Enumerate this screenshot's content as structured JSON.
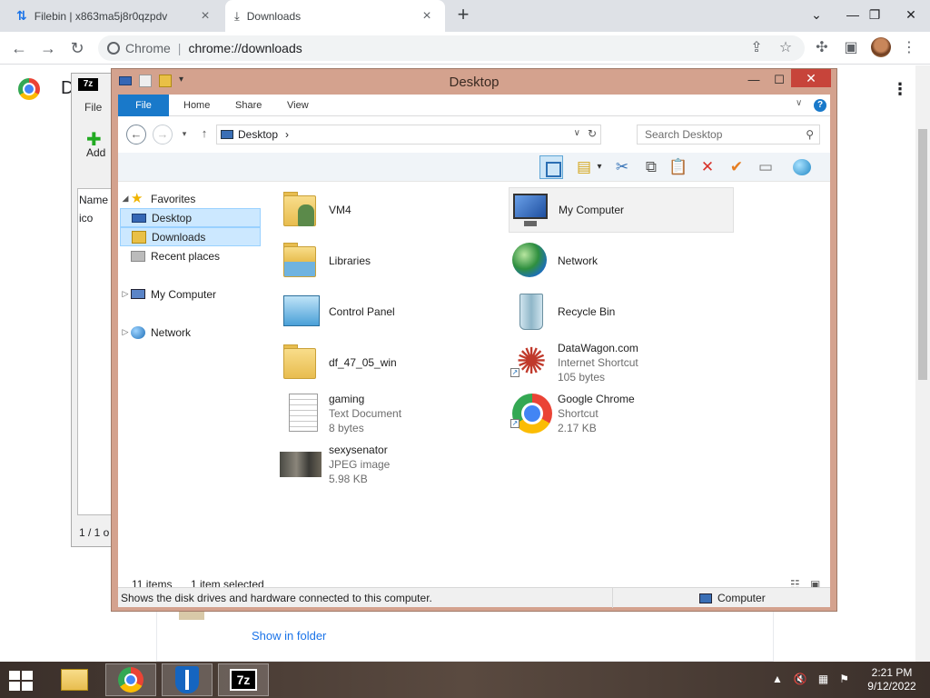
{
  "browser": {
    "tabs": [
      {
        "title": "Filebin | x863ma5j8r0qzpdv",
        "active": false
      },
      {
        "title": "Downloads",
        "active": true
      }
    ],
    "new_tab": "+",
    "omnibox": {
      "site": "Chrome",
      "separator": "|",
      "url": "chrome://downloads"
    },
    "window_controls": {
      "minimize": "—",
      "restore": "❐",
      "close": "✕",
      "dropdown": "⌄"
    },
    "icons": {
      "back": "back-arrow-icon",
      "forward": "forward-arrow-icon",
      "reload": "reload-icon",
      "share": "share-icon",
      "bookmark": "star-icon",
      "extensions": "puzzle-icon",
      "sidepanel": "side-panel-icon",
      "menu": "kebab-menu-icon"
    }
  },
  "downloads_page": {
    "heading_initial": "D",
    "show_in_folder": "Show in folder",
    "menu": "⋮"
  },
  "sevenzip": {
    "logo": "7z",
    "menu_file": "File",
    "add_label": "Add",
    "column_name": "Name",
    "row_name": "ico",
    "status": "1 / 1 o"
  },
  "explorer": {
    "title": "Desktop",
    "window_controls": {
      "minimize": "—",
      "maximize": "☐",
      "close": "✕"
    },
    "ribbon_tabs": [
      "File",
      "Home",
      "Share",
      "View"
    ],
    "help": "?",
    "address": {
      "location": "Desktop",
      "chevron": "›"
    },
    "search_placeholder": "Search Desktop",
    "nav": {
      "favorites": "Favorites",
      "desktop": "Desktop",
      "downloads": "Downloads",
      "recent": "Recent places",
      "my_computer": "My Computer",
      "network": "Network"
    },
    "items": [
      {
        "name": "VM4",
        "line2": "",
        "line3": ""
      },
      {
        "name": "My Computer",
        "line2": "",
        "line3": ""
      },
      {
        "name": "Libraries",
        "line2": "",
        "line3": ""
      },
      {
        "name": "Network",
        "line2": "",
        "line3": ""
      },
      {
        "name": "Control Panel",
        "line2": "",
        "line3": ""
      },
      {
        "name": "Recycle Bin",
        "line2": "",
        "line3": ""
      },
      {
        "name": "df_47_05_win",
        "line2": "",
        "line3": ""
      },
      {
        "name": "DataWagon.com",
        "line2": "Internet Shortcut",
        "line3": "105 bytes"
      },
      {
        "name": "gaming",
        "line2": "Text Document",
        "line3": "8 bytes"
      },
      {
        "name": "Google Chrome",
        "line2": "Shortcut",
        "line3": "2.17 KB"
      },
      {
        "name": "sexysenator",
        "line2": "JPEG image",
        "line3": "5.98 KB"
      }
    ],
    "status": {
      "count": "11 items",
      "selected": "1 item selected"
    },
    "info": {
      "message": "Shows the disk drives and hardware connected to this computer.",
      "location": "Computer"
    }
  },
  "taskbar": {
    "apps": [
      "file-explorer",
      "chrome",
      "windows-defender",
      "7-zip"
    ],
    "sevenzip_label": "7z",
    "clock": {
      "time": "2:21 PM",
      "date": "9/12/2022"
    }
  }
}
